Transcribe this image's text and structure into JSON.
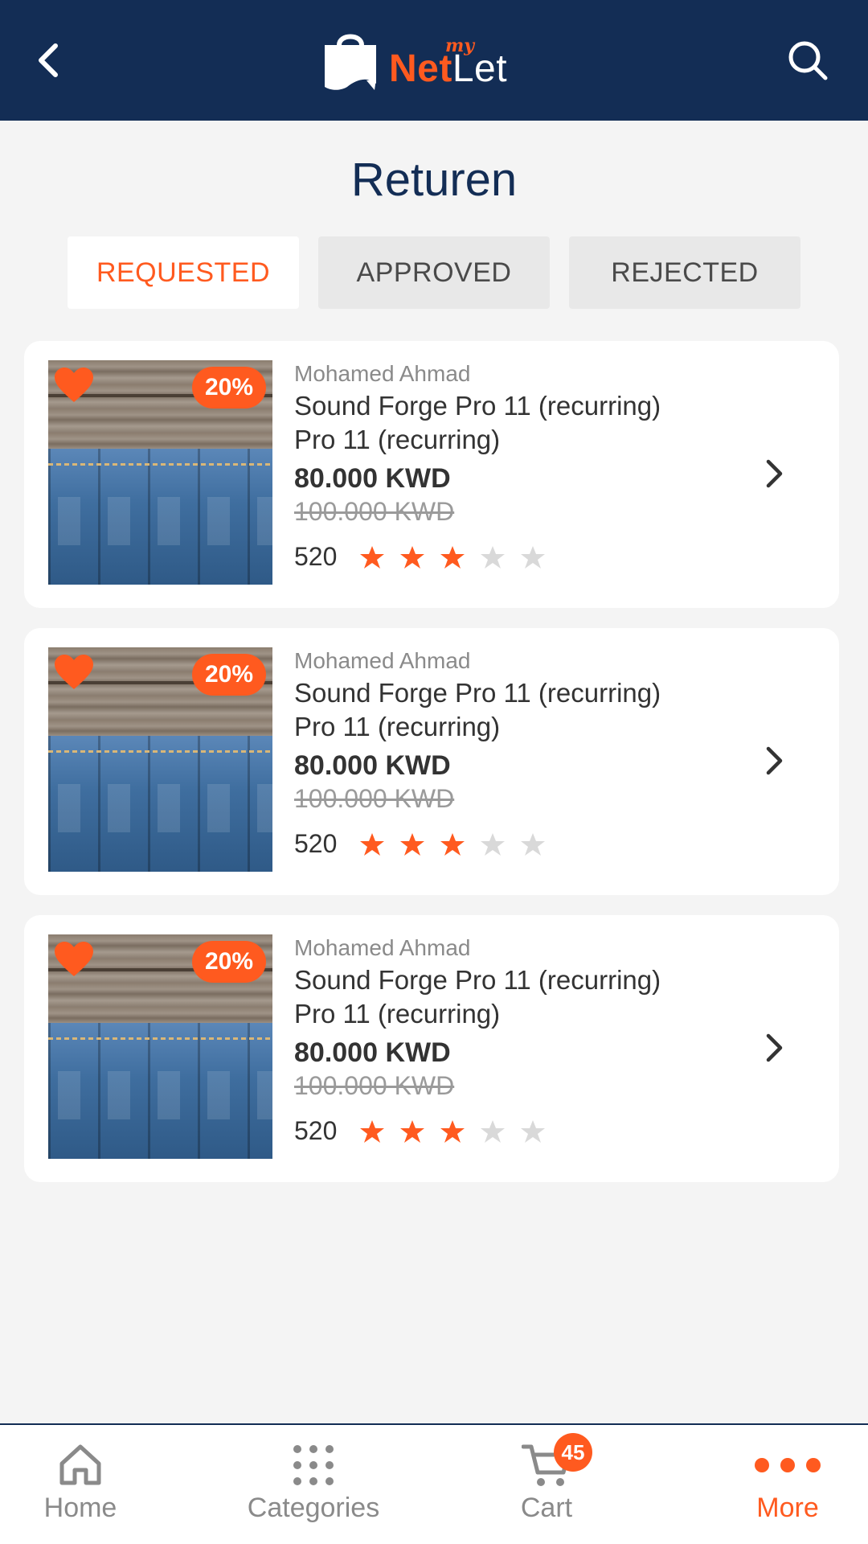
{
  "header": {
    "logo_my": "my",
    "logo_net": "Net",
    "logo_let": "Let"
  },
  "page": {
    "title": "Returen"
  },
  "tabs": [
    {
      "label": "REQUESTED",
      "active": true
    },
    {
      "label": "APPROVED",
      "active": false
    },
    {
      "label": "REJECTED",
      "active": false
    }
  ],
  "items": [
    {
      "discount": "20%",
      "seller": "Mohamed Ahmad",
      "name_line1": "Sound Forge Pro 11 (recurring)",
      "name_line2": "Pro 11 (recurring)",
      "price": "80.000 KWD",
      "old_price": "100.000 KWD",
      "review_count": "520",
      "rating": 3,
      "rating_max": 5
    },
    {
      "discount": "20%",
      "seller": "Mohamed Ahmad",
      "name_line1": "Sound Forge Pro 11 (recurring)",
      "name_line2": "Pro 11 (recurring)",
      "price": "80.000 KWD",
      "old_price": "100.000 KWD",
      "review_count": "520",
      "rating": 3,
      "rating_max": 5
    },
    {
      "discount": "20%",
      "seller": "Mohamed Ahmad",
      "name_line1": "Sound Forge Pro 11 (recurring)",
      "name_line2": "Pro 11 (recurring)",
      "price": "80.000 KWD",
      "old_price": "100.000 KWD",
      "review_count": "520",
      "rating": 3,
      "rating_max": 5
    }
  ],
  "bottom_nav": {
    "home": "Home",
    "categories": "Categories",
    "cart": "Cart",
    "cart_badge": "45",
    "more": "More"
  },
  "colors": {
    "header_bg": "#132d55",
    "accent": "#ff5a1f",
    "star_off": "#d9d9d9"
  },
  "icons": [
    "back-icon",
    "search-icon",
    "shopping-bag-logo",
    "heart-icon",
    "star-icon",
    "chevron-right-icon",
    "home-icon",
    "grid-dots-icon",
    "cart-icon",
    "more-dots-icon"
  ]
}
